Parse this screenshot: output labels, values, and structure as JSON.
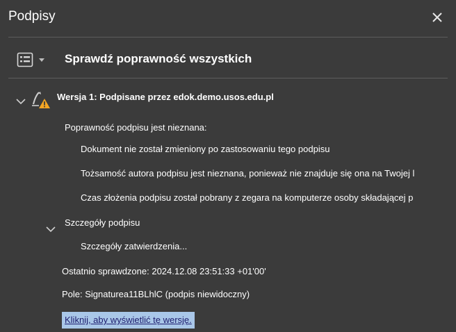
{
  "panel": {
    "title": "Podpisy"
  },
  "toolbar": {
    "validate_all_label": "Sprawdź poprawność wszystkich"
  },
  "signature": {
    "version_label": "Wersja 1: Podpisane przez edok.demo.usos.edu.pl",
    "validity_status": "Poprawność podpisu jest nieznana:",
    "details": [
      "Dokument nie został zmieniony po zastosowaniu tego podpisu",
      "Tożsamość autora podpisu jest nieznana, ponieważ nie znajduje się ona na Twojej l",
      "Czas złożenia podpisu został pobrany z zegara na komputerze osoby składającej p"
    ],
    "signature_details_label": "Szczegóły podpisu",
    "approval_details_label": "Szczegóły zatwierdzenia...",
    "last_checked": "Ostatnio sprawdzone: 2024.12.08 23:51:33 +01'00'",
    "field": "Pole: Signaturea11BLhlC (podpis niewidoczny)",
    "view_version_link": "Kliknij, aby wyświetlić tę wersję."
  },
  "icons": {
    "close": "close-icon",
    "options": "list-options-icon",
    "dropdown": "caret-down-icon",
    "expand": "chevron-down-icon",
    "signature": "signature-pen-icon",
    "warning": "warning-icon"
  },
  "colors": {
    "background": "#3b3b3b",
    "divider": "#5d5d5d",
    "warning": "#f5a623",
    "link_highlight": "#a9c7e8",
    "link_text": "#1d1d6e"
  }
}
